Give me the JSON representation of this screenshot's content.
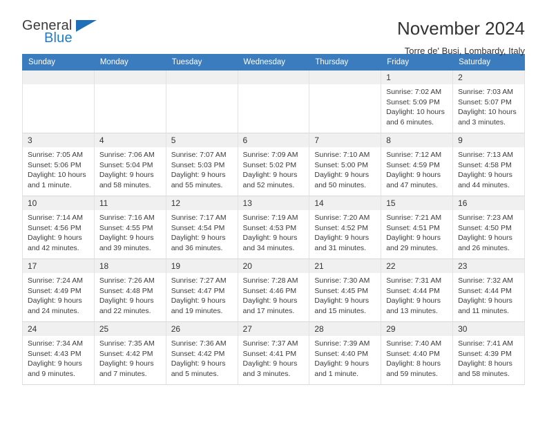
{
  "logo": {
    "word_general": "General",
    "word_blue": "Blue",
    "triangle_color": "#1f6fb8"
  },
  "header": {
    "title": "November 2024",
    "subtitle": "Torre de' Busi, Lombardy, Italy"
  },
  "theme": {
    "header_blue": "#3a7cbe",
    "daynum_band": "#f0f0f0",
    "text": "#333333"
  },
  "calendar": {
    "weekday_headers": [
      "Sunday",
      "Monday",
      "Tuesday",
      "Wednesday",
      "Thursday",
      "Friday",
      "Saturday"
    ],
    "weeks": [
      [
        {
          "day": "",
          "lines": []
        },
        {
          "day": "",
          "lines": []
        },
        {
          "day": "",
          "lines": []
        },
        {
          "day": "",
          "lines": []
        },
        {
          "day": "",
          "lines": []
        },
        {
          "day": "1",
          "lines": [
            "Sunrise: 7:02 AM",
            "Sunset: 5:09 PM",
            "Daylight: 10 hours",
            "and 6 minutes."
          ]
        },
        {
          "day": "2",
          "lines": [
            "Sunrise: 7:03 AM",
            "Sunset: 5:07 PM",
            "Daylight: 10 hours",
            "and 3 minutes."
          ]
        }
      ],
      [
        {
          "day": "3",
          "lines": [
            "Sunrise: 7:05 AM",
            "Sunset: 5:06 PM",
            "Daylight: 10 hours",
            "and 1 minute."
          ]
        },
        {
          "day": "4",
          "lines": [
            "Sunrise: 7:06 AM",
            "Sunset: 5:04 PM",
            "Daylight: 9 hours",
            "and 58 minutes."
          ]
        },
        {
          "day": "5",
          "lines": [
            "Sunrise: 7:07 AM",
            "Sunset: 5:03 PM",
            "Daylight: 9 hours",
            "and 55 minutes."
          ]
        },
        {
          "day": "6",
          "lines": [
            "Sunrise: 7:09 AM",
            "Sunset: 5:02 PM",
            "Daylight: 9 hours",
            "and 52 minutes."
          ]
        },
        {
          "day": "7",
          "lines": [
            "Sunrise: 7:10 AM",
            "Sunset: 5:00 PM",
            "Daylight: 9 hours",
            "and 50 minutes."
          ]
        },
        {
          "day": "8",
          "lines": [
            "Sunrise: 7:12 AM",
            "Sunset: 4:59 PM",
            "Daylight: 9 hours",
            "and 47 minutes."
          ]
        },
        {
          "day": "9",
          "lines": [
            "Sunrise: 7:13 AM",
            "Sunset: 4:58 PM",
            "Daylight: 9 hours",
            "and 44 minutes."
          ]
        }
      ],
      [
        {
          "day": "10",
          "lines": [
            "Sunrise: 7:14 AM",
            "Sunset: 4:56 PM",
            "Daylight: 9 hours",
            "and 42 minutes."
          ]
        },
        {
          "day": "11",
          "lines": [
            "Sunrise: 7:16 AM",
            "Sunset: 4:55 PM",
            "Daylight: 9 hours",
            "and 39 minutes."
          ]
        },
        {
          "day": "12",
          "lines": [
            "Sunrise: 7:17 AM",
            "Sunset: 4:54 PM",
            "Daylight: 9 hours",
            "and 36 minutes."
          ]
        },
        {
          "day": "13",
          "lines": [
            "Sunrise: 7:19 AM",
            "Sunset: 4:53 PM",
            "Daylight: 9 hours",
            "and 34 minutes."
          ]
        },
        {
          "day": "14",
          "lines": [
            "Sunrise: 7:20 AM",
            "Sunset: 4:52 PM",
            "Daylight: 9 hours",
            "and 31 minutes."
          ]
        },
        {
          "day": "15",
          "lines": [
            "Sunrise: 7:21 AM",
            "Sunset: 4:51 PM",
            "Daylight: 9 hours",
            "and 29 minutes."
          ]
        },
        {
          "day": "16",
          "lines": [
            "Sunrise: 7:23 AM",
            "Sunset: 4:50 PM",
            "Daylight: 9 hours",
            "and 26 minutes."
          ]
        }
      ],
      [
        {
          "day": "17",
          "lines": [
            "Sunrise: 7:24 AM",
            "Sunset: 4:49 PM",
            "Daylight: 9 hours",
            "and 24 minutes."
          ]
        },
        {
          "day": "18",
          "lines": [
            "Sunrise: 7:26 AM",
            "Sunset: 4:48 PM",
            "Daylight: 9 hours",
            "and 22 minutes."
          ]
        },
        {
          "day": "19",
          "lines": [
            "Sunrise: 7:27 AM",
            "Sunset: 4:47 PM",
            "Daylight: 9 hours",
            "and 19 minutes."
          ]
        },
        {
          "day": "20",
          "lines": [
            "Sunrise: 7:28 AM",
            "Sunset: 4:46 PM",
            "Daylight: 9 hours",
            "and 17 minutes."
          ]
        },
        {
          "day": "21",
          "lines": [
            "Sunrise: 7:30 AM",
            "Sunset: 4:45 PM",
            "Daylight: 9 hours",
            "and 15 minutes."
          ]
        },
        {
          "day": "22",
          "lines": [
            "Sunrise: 7:31 AM",
            "Sunset: 4:44 PM",
            "Daylight: 9 hours",
            "and 13 minutes."
          ]
        },
        {
          "day": "23",
          "lines": [
            "Sunrise: 7:32 AM",
            "Sunset: 4:44 PM",
            "Daylight: 9 hours",
            "and 11 minutes."
          ]
        }
      ],
      [
        {
          "day": "24",
          "lines": [
            "Sunrise: 7:34 AM",
            "Sunset: 4:43 PM",
            "Daylight: 9 hours",
            "and 9 minutes."
          ]
        },
        {
          "day": "25",
          "lines": [
            "Sunrise: 7:35 AM",
            "Sunset: 4:42 PM",
            "Daylight: 9 hours",
            "and 7 minutes."
          ]
        },
        {
          "day": "26",
          "lines": [
            "Sunrise: 7:36 AM",
            "Sunset: 4:42 PM",
            "Daylight: 9 hours",
            "and 5 minutes."
          ]
        },
        {
          "day": "27",
          "lines": [
            "Sunrise: 7:37 AM",
            "Sunset: 4:41 PM",
            "Daylight: 9 hours",
            "and 3 minutes."
          ]
        },
        {
          "day": "28",
          "lines": [
            "Sunrise: 7:39 AM",
            "Sunset: 4:40 PM",
            "Daylight: 9 hours",
            "and 1 minute."
          ]
        },
        {
          "day": "29",
          "lines": [
            "Sunrise: 7:40 AM",
            "Sunset: 4:40 PM",
            "Daylight: 8 hours",
            "and 59 minutes."
          ]
        },
        {
          "day": "30",
          "lines": [
            "Sunrise: 7:41 AM",
            "Sunset: 4:39 PM",
            "Daylight: 8 hours",
            "and 58 minutes."
          ]
        }
      ]
    ]
  }
}
